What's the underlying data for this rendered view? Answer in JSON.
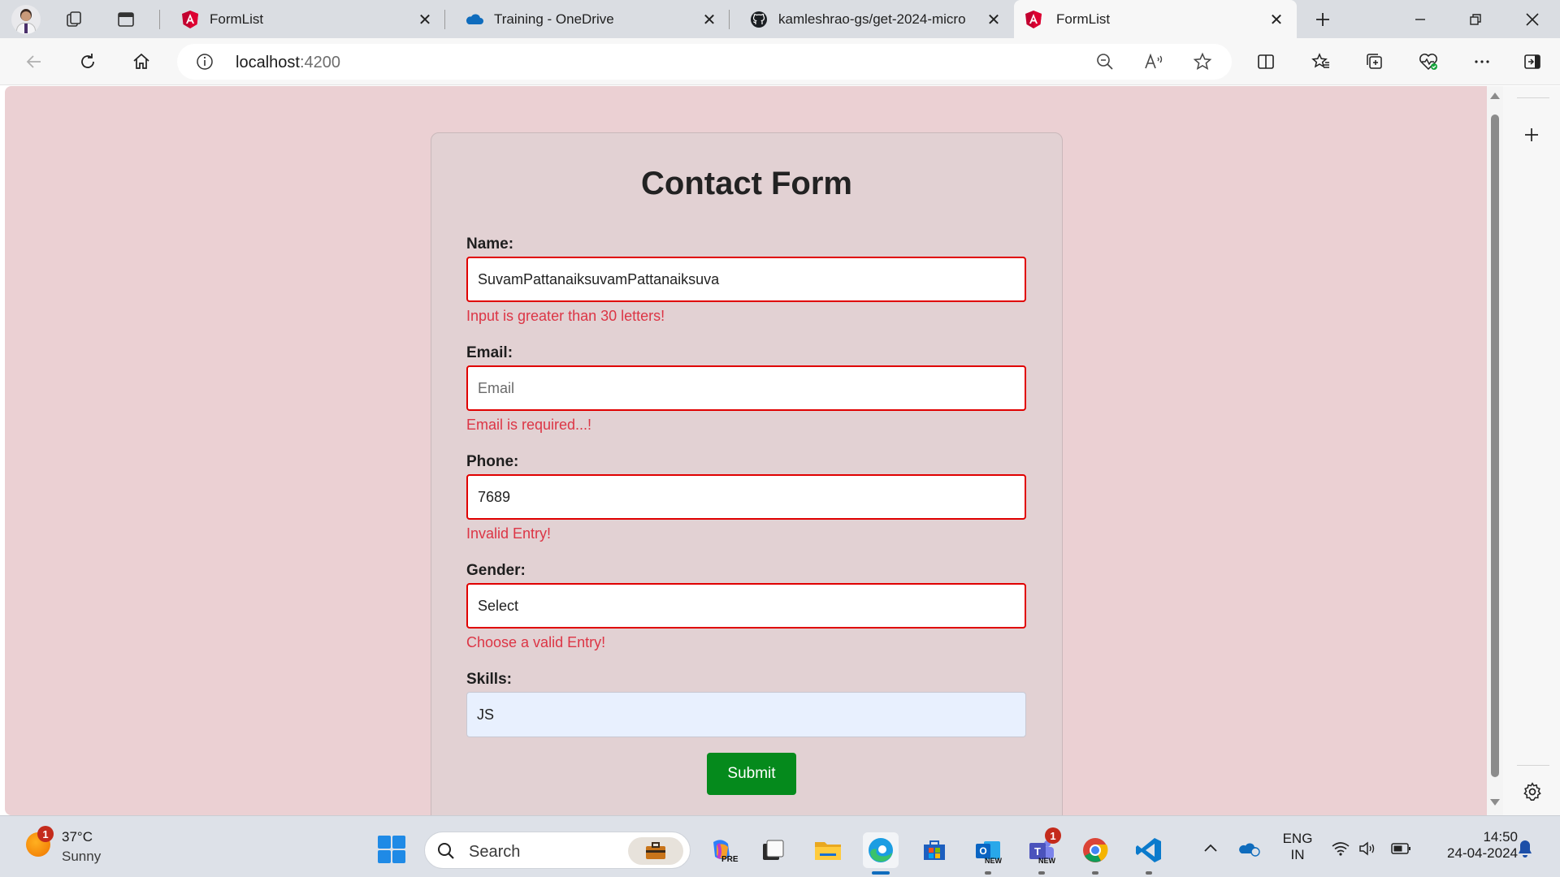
{
  "browser": {
    "tabs": [
      {
        "title": "FormList",
        "icon": "angular-icon",
        "active": false
      },
      {
        "title": "Training - OneDrive",
        "icon": "onedrive-icon",
        "active": false
      },
      {
        "title": "kamleshrao-gs/get-2024-micro",
        "icon": "github-icon",
        "active": false
      },
      {
        "title": "FormList",
        "icon": "angular-icon",
        "active": true
      }
    ],
    "url_host": "localhost",
    "url_port": ":4200"
  },
  "form": {
    "title": "Contact Form",
    "fields": {
      "name": {
        "label": "Name:",
        "value": "SuvamPattanaiksuvamPattanaiksuva",
        "error": "Input is greater than 30 letters!"
      },
      "email": {
        "label": "Email:",
        "value": "",
        "placeholder": "Email",
        "error": "Email is required...!"
      },
      "phone": {
        "label": "Phone:",
        "value": "7689",
        "error": "Invalid Entry!"
      },
      "gender": {
        "label": "Gender:",
        "selected": "Select",
        "error": "Choose a valid Entry!"
      },
      "skills": {
        "label": "Skills:",
        "value": "JS"
      }
    },
    "submit_label": "Submit"
  },
  "colors": {
    "page_bg": "#ebd0d3",
    "card_bg": "#e2d1d3",
    "error": "#dc3545",
    "invalid_border": "#e00000",
    "submit_bg": "#058a1c"
  },
  "taskbar": {
    "weather_temp": "37°C",
    "weather_desc": "Sunny",
    "weather_badge": "1",
    "search_label": "Search",
    "teams_badge": "1",
    "lang_line1": "ENG",
    "lang_line2": "IN",
    "time": "14:50",
    "date": "24-04-2024",
    "copilot_tag": "PRE",
    "outlook_tag": "NEW",
    "teams_tag": "NEW"
  }
}
